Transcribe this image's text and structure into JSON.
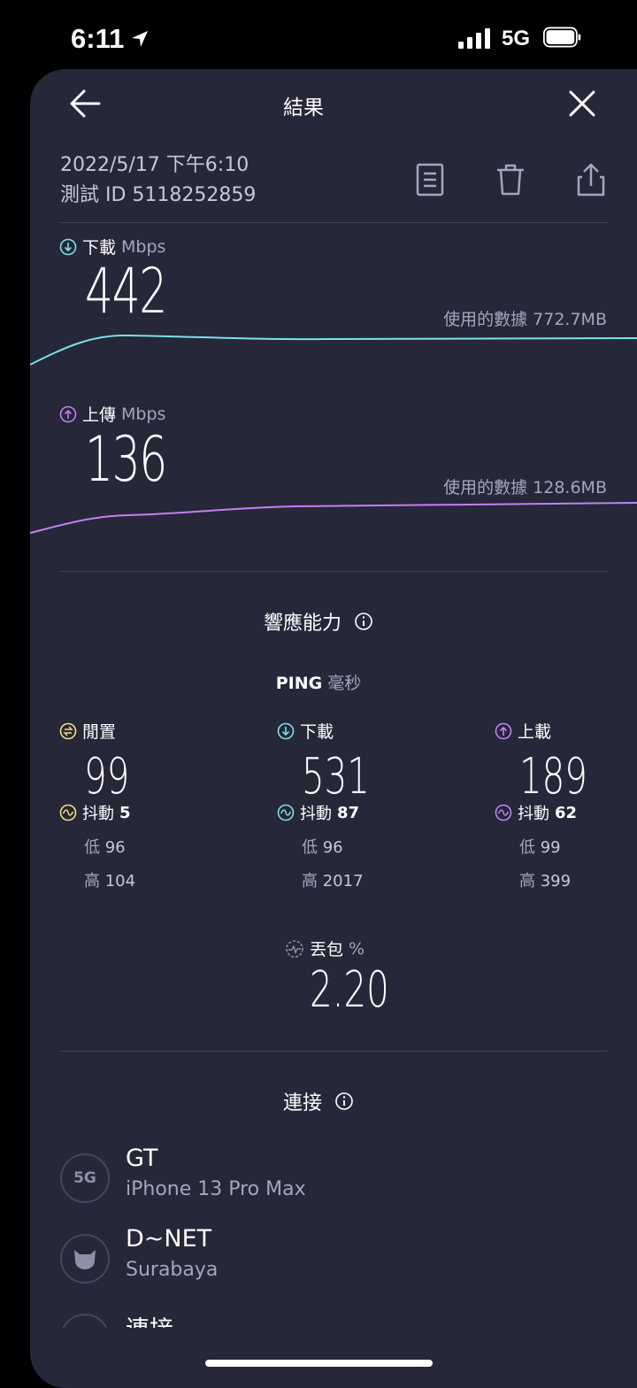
{
  "status_bar": {
    "time": "6:11",
    "network": "5G"
  },
  "header": {
    "title": "結果"
  },
  "result": {
    "datetime": "2022/5/17 下午6:10",
    "test_id": "測試 ID 5118252859"
  },
  "download": {
    "label": "下載",
    "unit": "Mbps",
    "value": "442",
    "data_used": "使用的數據 772.7MB"
  },
  "upload": {
    "label": "上傳",
    "unit": "Mbps",
    "value": "136",
    "data_used": "使用的數據 128.6MB"
  },
  "responsiveness": {
    "title": "響應能力",
    "ping_label": "PING",
    "ping_unit": "毫秒",
    "columns": [
      {
        "label": "閒置",
        "value": "99",
        "jitter_label": "抖動",
        "jitter": "5",
        "low_label": "低",
        "low": "96",
        "high_label": "高",
        "high": "104"
      },
      {
        "label": "下載",
        "value": "531",
        "jitter_label": "抖動",
        "jitter": "87",
        "low_label": "低",
        "low": "96",
        "high_label": "高",
        "high": "2017"
      },
      {
        "label": "上載",
        "value": "189",
        "jitter_label": "抖動",
        "jitter": "62",
        "low_label": "低",
        "low": "99",
        "high_label": "高",
        "high": "399"
      }
    ],
    "packet_loss": {
      "label": "丟包",
      "unit": "%",
      "value": "2.20"
    }
  },
  "connections": {
    "title": "連接",
    "items": [
      {
        "badge": "5G",
        "name": "GT",
        "detail": "iPhone 13 Pro Max"
      },
      {
        "badge": "",
        "name": "D~NET",
        "detail": "Surabaya"
      },
      {
        "badge": "",
        "name": "連接",
        "detail": ""
      }
    ]
  },
  "colors": {
    "background": "#262739",
    "download_accent": "#7fe0e8",
    "upload_accent": "#c57ff0",
    "idle_accent": "#f3e27a"
  }
}
